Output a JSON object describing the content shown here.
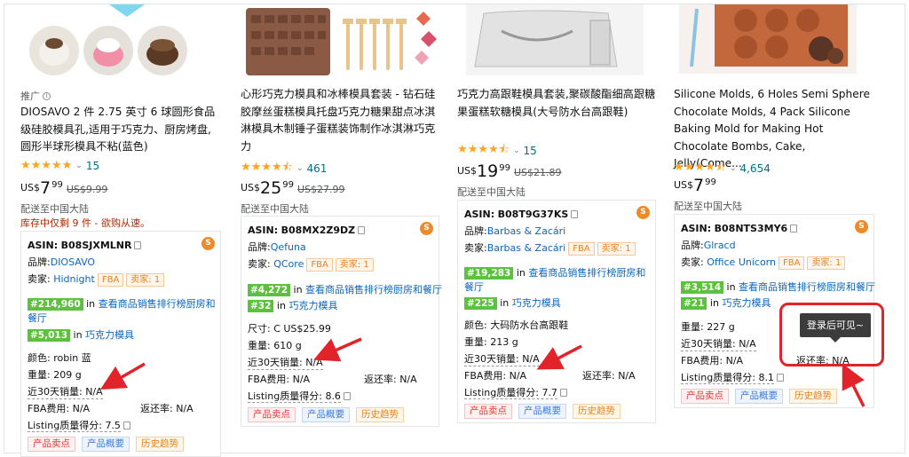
{
  "products": [
    {
      "ad_label": "推广",
      "title": "DIOSAVO 2 件 2.75 英寸 6 球圆形食品级硅胶模具孔,适用于巧克力、厨房烤盘,圆形半球形模具不粘(蓝色)",
      "rating": 5.0,
      "review_count": "15",
      "price": {
        "currency": "US$",
        "whole": "7",
        "fraction": "99",
        "was": "US$9.99"
      },
      "ship_to": "配送至中国大陆",
      "stock": "库存中仅剩 9 件 - 欲购从速。",
      "asin_label": "ASIN:",
      "asin": "B08SJXMLNR",
      "brand_label": "品牌:",
      "brand": "DIOSAVO",
      "seller_label": "卖家:",
      "seller": "Hidnight",
      "fba": "FBA",
      "seller_count": "卖家: 1",
      "rank1": "#214,960",
      "rank1_text": "查看商品销售排行榜厨房和餐厅",
      "rank2": "#5,013",
      "rank2_text": "巧克力模具",
      "color": "颜色: robin 蓝",
      "weight": "重量: 209 g",
      "sales30": "近30天销量: N/A",
      "fba_fee": "FBA费用: N/A",
      "return_rate": "返还率: N/A",
      "listing_score": "Listing质量得分: 7.5",
      "buttons": [
        "产品卖点",
        "产品概要",
        "历史趋势"
      ]
    },
    {
      "title": "心形巧克力模具和冰棒模具套装 - 钻石硅胶摩丝蛋糕模具托盘巧克力糖果甜点冰淇淋模具木制锤子蛋糕装饰制作冰淇淋巧克力",
      "rating": 4.5,
      "review_count": "461",
      "price": {
        "currency": "US$",
        "whole": "25",
        "fraction": "99",
        "was": "US$27.99"
      },
      "ship_to": "配送至中国大陆",
      "asin_label": "ASIN:",
      "asin": "B08MX2Z9DZ",
      "brand_label": "品牌:",
      "brand": "Qefuna",
      "seller_label": "卖家:",
      "seller": "QCore",
      "fba": "FBA",
      "seller_count": "卖家: 1",
      "rank1": "#4,272",
      "rank1_text": "查看商品销售排行榜厨房和餐厅",
      "rank2": "#32",
      "rank2_text": "巧克力模具",
      "size": "尺寸: C US$25.99",
      "weight": "重量: 610 g",
      "sales30": "近30天销量: N/A",
      "fba_fee": "FBA费用: N/A",
      "return_rate": "返还率: N/A",
      "listing_score": "Listing质量得分: 8.6",
      "buttons": [
        "产品卖点",
        "产品概要",
        "历史趋势"
      ]
    },
    {
      "title": "巧克力高跟鞋模具套装,聚碳酸酯细高跟糖果蛋糕软糖模具(大号防水台高跟鞋)",
      "rating": 4.5,
      "review_count": "15",
      "price": {
        "currency": "US$",
        "whole": "19",
        "fraction": "99",
        "was": "US$21.89"
      },
      "ship_to": "配送至中国大陆",
      "asin_label": "ASIN:",
      "asin": "B08T9G37KS",
      "brand_label": "品牌:",
      "brand": "Barbas & Zacári",
      "seller_label": "卖家:",
      "seller": "Barbas & Zacári",
      "fba": "FBA",
      "seller_count": "卖家: 1",
      "rank1": "#19,283",
      "rank1_text": "查看商品销售排行榜厨房和餐厅",
      "rank2": "#225",
      "rank2_text": "巧克力模具",
      "color": "颜色: 大码防水台高跟鞋",
      "weight": "重量: 213 g",
      "sales30": "近30天销量: N/A",
      "fba_fee": "FBA费用: N/A",
      "return_rate": "返还率: N/A",
      "listing_score": "Listing质量得分: 7.7",
      "buttons": [
        "产品卖点",
        "产品概要",
        "历史趋势"
      ]
    },
    {
      "title": "Silicone Molds, 6 Holes Semi Sphere Chocolate Molds, 4 Pack Silicone Baking Mold for Making Hot Chocolate Bombs, Cake, Jelly(Come...",
      "rating": 4.5,
      "review_count": "4,654",
      "price": {
        "currency": "US$",
        "whole": "7",
        "fraction": "99"
      },
      "ship_to": "配送至中国大陆",
      "asin_label": "ASIN:",
      "asin": "B08NTS3MY6",
      "brand_label": "品牌:",
      "brand": "Glracd",
      "seller_label": "卖家:",
      "seller": "Office Unicorn",
      "fba": "FBA",
      "seller_count": "卖家: 1",
      "rank1": "#3,514",
      "rank1_text": "查看商品销售排行榜厨房和餐厅",
      "rank2": "#21",
      "rank2_text": "巧克力模具",
      "weight": "重量: 227 g",
      "sales30": "近30天销量: N/A",
      "fba_fee": "FBA费用: N/A",
      "return_rate": "返还率: N/A",
      "listing_score": "Listing质量得分: 8.1",
      "buttons": [
        "产品卖点",
        "产品概要",
        "历史趋势"
      ]
    }
  ],
  "tooltip": "登录后可见~",
  "in_label": "in",
  "colors": {
    "arrow": "#e2242a",
    "rank_bg": "#5cc23d",
    "star": "#ffa41c",
    "link": "#0a66c2"
  }
}
